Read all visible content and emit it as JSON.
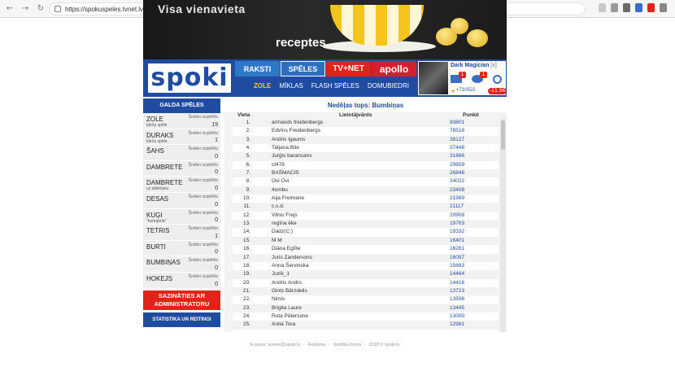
{
  "browser": {
    "url": "https://spokuspeles.tvnet.lv/games/?usq=online_full_top&zur_game=balls"
  },
  "banner": {
    "headline": "Visa vienavieta",
    "brand": "receptes"
  },
  "header": {
    "logo": "spoki",
    "tabs": [
      "RAKSTI",
      "SPĒLES",
      "TV+NET",
      "apollo"
    ],
    "sub_nav": [
      "ZOLE",
      "MĪKLAS",
      "FLASH SPĒLES",
      "DOMUBIEDRI"
    ],
    "user": {
      "name": "Dark Magician",
      "name_suffix": "[x]",
      "mail_badge": "1",
      "eye_badge": "1",
      "score": "+710522",
      "neg_score": "-11.96"
    }
  },
  "sidebar": {
    "title": "GALDA SPĒLES",
    "today_label": "Šodien izspēlēts",
    "games": [
      {
        "name": "ZOLE",
        "sub": "kāršu spēle",
        "count": "19"
      },
      {
        "name": "DURAKS",
        "sub": "kāršu spēle",
        "count": "1"
      },
      {
        "name": "ŠAHS",
        "sub": "",
        "count": "0"
      },
      {
        "name": "DAMBRETE",
        "sub": "",
        "count": "0"
      },
      {
        "name": "DAMBRETE",
        "sub": "uz atdošanu",
        "count": "0"
      },
      {
        "name": "DESAS",
        "sub": "",
        "count": "0"
      },
      {
        "name": "KUĢI",
        "sub": "\"kartupelis\"",
        "count": "0"
      },
      {
        "name": "TETRIS",
        "sub": "",
        "count": "1"
      },
      {
        "name": "BURTI",
        "sub": "",
        "count": "0"
      },
      {
        "name": "BUMBIŅAS",
        "sub": "",
        "count": "0"
      },
      {
        "name": "HOKEJS",
        "sub": "",
        "count": "0"
      }
    ],
    "contact_label": "SAZINĀTIES AR ADMINISTRATORU",
    "stats_label": "STATISTIKA UN REITINGI"
  },
  "content": {
    "title": "Nedēļas tops: Bumbiņas",
    "columns": [
      "Vieta",
      "Lietotājvārds",
      "Punkti"
    ],
    "rows": [
      {
        "place": "1.",
        "user": "armands freidenbergs",
        "points": "93801"
      },
      {
        "place": "2.",
        "user": "Edvīns Freidenbergs",
        "points": "78516"
      },
      {
        "place": "3.",
        "user": "Andris Igaunis",
        "points": "38127"
      },
      {
        "place": "4.",
        "user": "Tatjana Bite",
        "points": "37448"
      },
      {
        "place": "5.",
        "user": "Jurģis barancans",
        "points": "31866"
      },
      {
        "place": "6.",
        "user": "ct478",
        "points": "29859"
      },
      {
        "place": "7.",
        "user": "BAŠMACIS",
        "points": "26848"
      },
      {
        "place": "8.",
        "user": "Ovi Ovi",
        "points": "24022"
      },
      {
        "place": "9.",
        "user": "4ombu",
        "points": "23408"
      },
      {
        "place": "10.",
        "user": "Aija Freimane",
        "points": "21989"
      },
      {
        "place": "11.",
        "user": "c.s.d.",
        "points": "21117"
      },
      {
        "place": "12.",
        "user": "Vilnis Frejs",
        "points": "20908"
      },
      {
        "place": "13.",
        "user": "regīna ēke",
        "points": "19763"
      },
      {
        "place": "14.",
        "user": "Dadz(C:)",
        "points": "19332"
      },
      {
        "place": "15.",
        "user": "M M",
        "points": "16401"
      },
      {
        "place": "16.",
        "user": "Diāna Eglīte",
        "points": "16261"
      },
      {
        "place": "17.",
        "user": "Juris Zandersons",
        "points": "16097"
      },
      {
        "place": "18.",
        "user": "Anna Šervinska",
        "points": "15683"
      },
      {
        "place": "19.",
        "user": "Juzik_1",
        "points": "14464"
      },
      {
        "place": "20.",
        "user": "Andris Andrs",
        "points": "14416"
      },
      {
        "place": "21.",
        "user": "Gints Bārzdelis",
        "points": "13723"
      },
      {
        "place": "22.",
        "user": "Nimis",
        "points": "13598"
      },
      {
        "place": "23.",
        "user": "Brigita Laure",
        "points": "13445"
      },
      {
        "place": "24.",
        "user": "Ruta Pētersone",
        "points": "13000"
      },
      {
        "place": "25.",
        "user": "Anita Tora",
        "points": "12981"
      }
    ]
  },
  "footer": {
    "items": [
      "E-pasts: speles@spoki.lv",
      "Reklāma",
      "Sodītbu forma",
      "2018 © spoki.lv"
    ]
  },
  "colors": {
    "brand_blue": "#1f4ba0",
    "accent_red": "#e2231a",
    "active_yellow": "#ffd200"
  }
}
